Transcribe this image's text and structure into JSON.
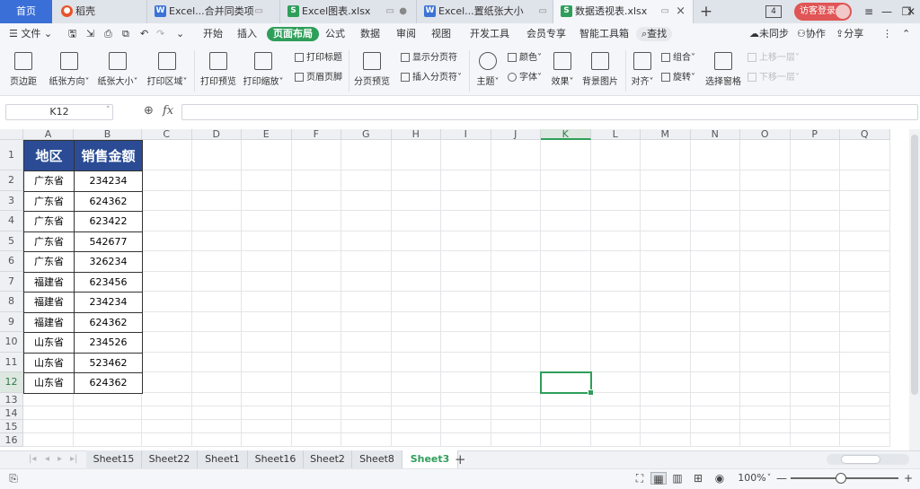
{
  "tabs": {
    "home": "首页",
    "items": [
      {
        "label": "稻壳",
        "icon": "docer-icon"
      },
      {
        "label": "Excel...合并同类项",
        "icon": "writer-doc-icon"
      },
      {
        "label": "Excel图表.xlsx",
        "icon": "sheet-icon"
      },
      {
        "label": "Excel...置纸张大小",
        "icon": "writer-doc-icon"
      },
      {
        "label": "数据透视表.xlsx",
        "icon": "sheet-icon"
      }
    ],
    "new_tab": "+",
    "window_count": "4",
    "visitor_login": "访客登录"
  },
  "menubar": {
    "file": "文件",
    "items": [
      "开始",
      "插入",
      "页面布局",
      "公式",
      "数据",
      "审阅",
      "视图",
      "开发工具",
      "会员专享",
      "智能工具箱"
    ],
    "active": "页面布局",
    "search": "查找",
    "sync": "未同步",
    "collab": "协作",
    "share": "分享"
  },
  "ribbon": {
    "margins": "页边距",
    "orientation": "纸张方向",
    "size": "纸张大小",
    "print_area": "打印区域",
    "print_preview": "打印预览",
    "print_scale": "打印缩放",
    "print_titles": "打印标题",
    "header_footer": "页眉页脚",
    "page_break_preview": "分页预览",
    "show_page_breaks": "显示分页符",
    "insert_page_break": "插入分页符",
    "theme": "主题",
    "colors": "颜色",
    "fonts": "字体",
    "effects": "效果",
    "background": "背景图片",
    "align": "对齐",
    "group": "组合",
    "rotate": "旋转",
    "selection_pane": "选择窗格",
    "bring_forward": "上移一层",
    "send_backward": "下移一层"
  },
  "formula": {
    "cell_ref": "K12",
    "fx": "fx",
    "value": ""
  },
  "grid": {
    "columns": [
      "A",
      "B",
      "C",
      "D",
      "E",
      "F",
      "G",
      "H",
      "I",
      "J",
      "K",
      "L",
      "M",
      "N",
      "O",
      "P",
      "Q"
    ],
    "selected_column": "K",
    "rows": [
      "1",
      "2",
      "3",
      "4",
      "5",
      "6",
      "7",
      "8",
      "9",
      "10",
      "11",
      "12",
      "13",
      "14",
      "15",
      "16"
    ],
    "selected_row": "12",
    "table": {
      "headers": [
        "地区",
        "销售金额"
      ],
      "rows": [
        [
          "广东省",
          "234234"
        ],
        [
          "广东省",
          "624362"
        ],
        [
          "广东省",
          "623422"
        ],
        [
          "广东省",
          "542677"
        ],
        [
          "广东省",
          "326234"
        ],
        [
          "福建省",
          "623456"
        ],
        [
          "福建省",
          "234234"
        ],
        [
          "福建省",
          "624362"
        ],
        [
          "山东省",
          "234526"
        ],
        [
          "山东省",
          "523462"
        ],
        [
          "山东省",
          "624362"
        ]
      ]
    }
  },
  "sheets": {
    "tabs": [
      "Sheet15",
      "Sheet22",
      "Sheet1",
      "Sheet16",
      "Sheet2",
      "Sheet8",
      "Sheet3"
    ],
    "active": "Sheet3",
    "add": "+"
  },
  "status": {
    "zoom": "100%",
    "zoom_minus": "—",
    "zoom_plus": "+"
  },
  "colors": {
    "accent": "#2f9e5a",
    "header_fill": "#2b4c94",
    "home_tab": "#3b6fd8"
  }
}
